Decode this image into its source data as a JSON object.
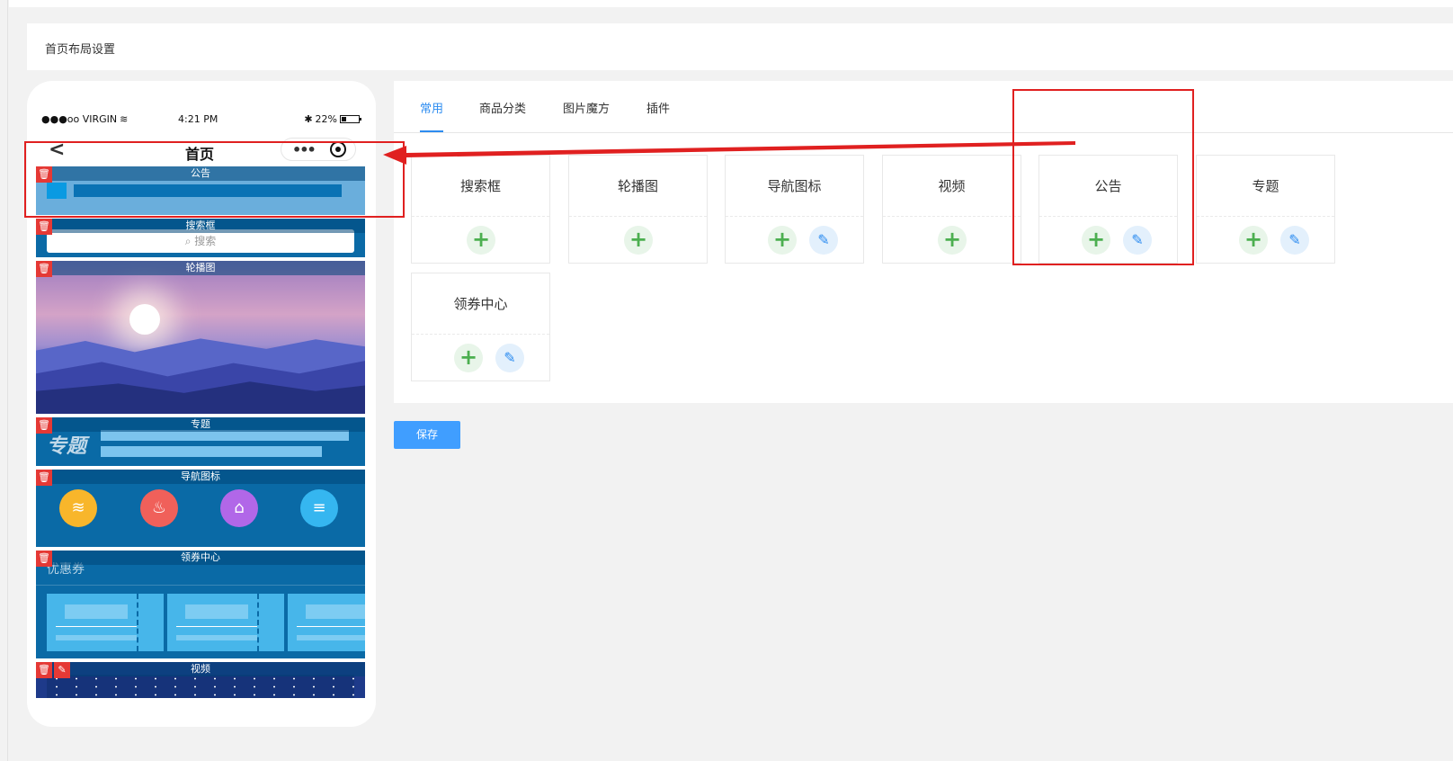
{
  "page_title": "首页布局设置",
  "phone": {
    "status": {
      "carrier": "●●●oo VIRGIN",
      "time": "4:21 PM",
      "battery": "22%"
    },
    "nav_title": "首页",
    "modules": [
      {
        "label": "公告"
      },
      {
        "label": "搜索框",
        "placeholder": "搜索"
      },
      {
        "label": "轮播图"
      },
      {
        "label": "专题",
        "watermark": "专题"
      },
      {
        "label": "导航图标"
      },
      {
        "label": "领券中心",
        "watermark": "优惠券"
      },
      {
        "label": "视频"
      }
    ],
    "nav_icon_colors": [
      "#f8b62b",
      "#f0605a",
      "#b167e8",
      "#35b6f0"
    ]
  },
  "tabs": [
    {
      "label": "常用",
      "active": true
    },
    {
      "label": "商品分类",
      "active": false
    },
    {
      "label": "图片魔方",
      "active": false
    },
    {
      "label": "插件",
      "active": false
    }
  ],
  "components": [
    {
      "name": "搜索框",
      "editable": false
    },
    {
      "name": "轮播图",
      "editable": false
    },
    {
      "name": "导航图标",
      "editable": true
    },
    {
      "name": "视频",
      "editable": false
    },
    {
      "name": "公告",
      "editable": true
    },
    {
      "name": "专题",
      "editable": true
    },
    {
      "name": "领券中心",
      "editable": true
    }
  ],
  "save_label": "保存",
  "colors": {
    "accent": "#2d8cf0",
    "highlight": "#e02020",
    "add": "#4caf50"
  }
}
